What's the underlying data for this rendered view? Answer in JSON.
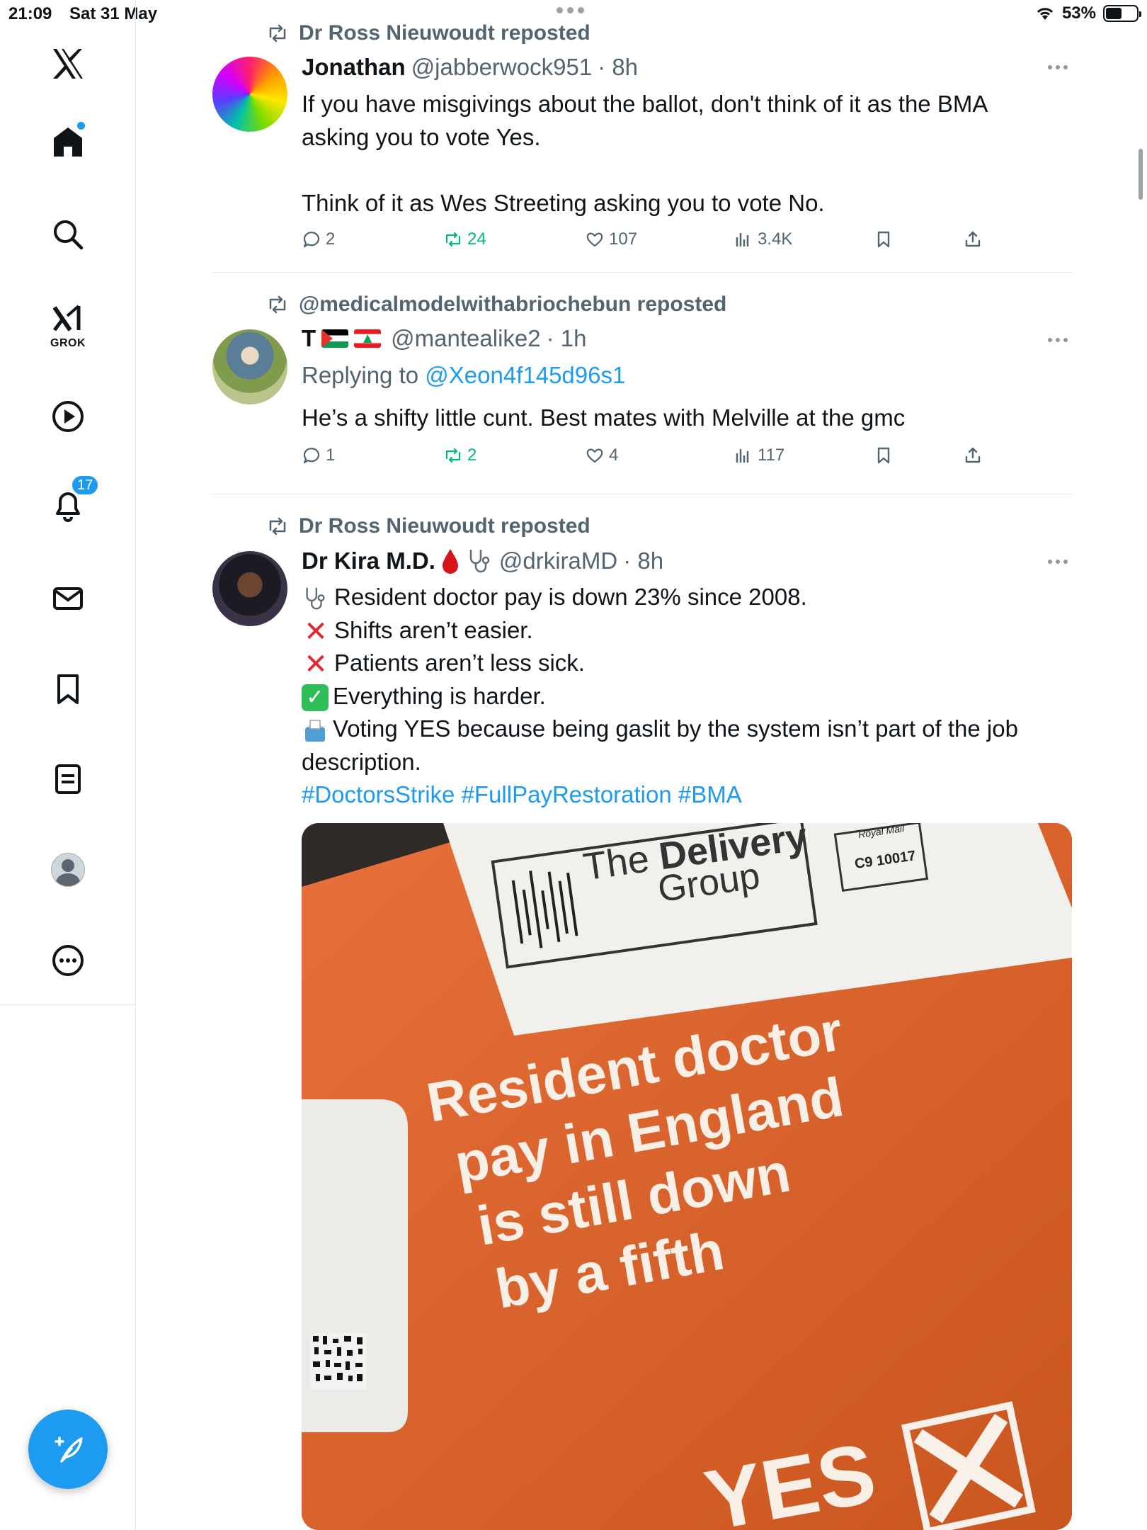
{
  "status_bar": {
    "time": "21:09",
    "date": "Sat 31 May",
    "battery": "53%"
  },
  "sidebar": {
    "grok_label": "GROK",
    "notifications_badge": "17"
  },
  "tweets": [
    {
      "reposted_by": "Dr Ross Nieuwoudt reposted",
      "name": "Jonathan",
      "handle": "@jabberwock951",
      "time": "· 8h",
      "lines": [
        "If you have misgivings about the ballot, don't think of it as the BMA",
        "asking you to vote Yes.",
        "",
        "Think of it as Wes Streeting asking you to vote No."
      ],
      "replies": "2",
      "reposts": "24",
      "likes": "107",
      "views": "3.4K"
    },
    {
      "reposted_by": "@medicalmodelwithabriochebun reposted",
      "name": "T",
      "handle": "@mantealike2",
      "time": "· 1h",
      "replying_prefix": "Replying to ",
      "replying_to": "@Xeon4f145d96s1",
      "lines": [
        "He’s a shifty little cunt. Best mates with Melville at the gmc"
      ],
      "replies": "1",
      "reposts": "2",
      "likes": "4",
      "views": "117"
    },
    {
      "reposted_by": "Dr Ross Nieuwoudt reposted",
      "name": "Dr Kira M.D.",
      "handle": "@drkiraMD",
      "time": "· 8h",
      "lines": [
        "Resident doctor pay is down 23% since 2008.",
        "Shifts aren’t easier.",
        "Patients aren’t less sick.",
        "Everything is harder.",
        "Voting YES because being gaslit by the system isn’t part of the job",
        "description."
      ],
      "hashtags": "#DoctorsStrike #FullPayRestoration #BMA",
      "media": {
        "brand_line1": "The",
        "brand_line2": "Delivery",
        "brand_line3": "Group",
        "postage_top": "Royal Mail",
        "postage_code": "C9 10017",
        "headline": [
          "Resident doctor",
          "pay in England",
          "is still down",
          "by a fifth"
        ],
        "vote_text": "YES"
      }
    }
  ],
  "colors": {
    "accent": "#1d9bf0",
    "repost_green": "#00ba7c",
    "muted": "#536471",
    "envelope_orange": "#d8622b"
  }
}
